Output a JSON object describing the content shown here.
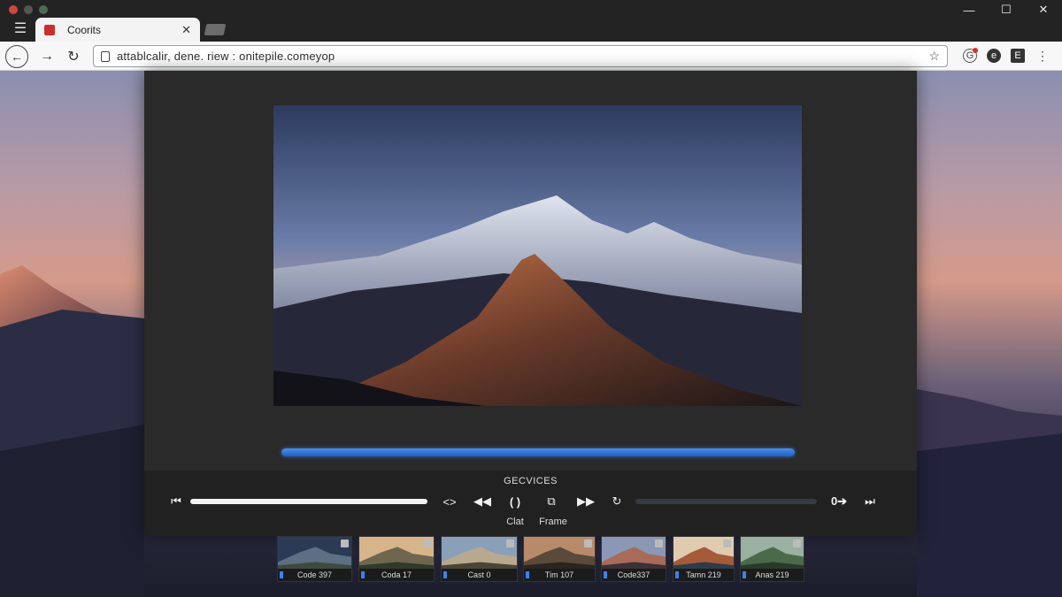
{
  "browser": {
    "tab_title": "Coorits",
    "tab_close": "✕",
    "url": "attablcalir, dene. riew : onitepile.comeyop",
    "menu_glyph": "☰",
    "window_controls": {
      "minimize": "—",
      "maximize": "☐",
      "close": "✕"
    },
    "nav": {
      "back": "←",
      "forward": "→",
      "reload": "↻",
      "star": "☆"
    },
    "extensions": [
      "G",
      "e",
      "E",
      "⋮"
    ]
  },
  "player": {
    "progress_fraction": 1.0,
    "section_title": "GECVICES",
    "controls": {
      "skip_back": "⏮",
      "embed": "<>",
      "rewind": "◀◀",
      "clat": "( )",
      "frame": "⧉",
      "forward": "▶▶",
      "loop": "↻",
      "next_arrow": "0➔",
      "skip_forward": "⏭"
    },
    "labels": {
      "clat": "Clat",
      "frame": "Frame"
    }
  },
  "thumbnails": [
    {
      "caption": "Code 397",
      "palette": [
        "#2b3a55",
        "#5d6f82",
        "#3d4a3d"
      ]
    },
    {
      "caption": "Coda 17",
      "palette": [
        "#d8b48a",
        "#6f6650",
        "#2f3a2a"
      ]
    },
    {
      "caption": "Cast 0",
      "palette": [
        "#8aa0b8",
        "#b8a890",
        "#4a4438"
      ]
    },
    {
      "caption": "Tim 107",
      "palette": [
        "#b98a6a",
        "#5a4a3a",
        "#2a2520"
      ]
    },
    {
      "caption": "Code337",
      "palette": [
        "#8a98b5",
        "#a86a5a",
        "#3a3036"
      ]
    },
    {
      "caption": "Tamn 219",
      "palette": [
        "#e0cbb0",
        "#a55a3a",
        "#2c3c4a"
      ]
    },
    {
      "caption": "Anas 219",
      "palette": [
        "#9ab0a0",
        "#4a6a4a",
        "#2a3a2a"
      ]
    }
  ],
  "colors": {
    "accent": "#2a6fd6",
    "player_bg": "#2a2a2a",
    "tab_favicon": "#c9302c"
  }
}
